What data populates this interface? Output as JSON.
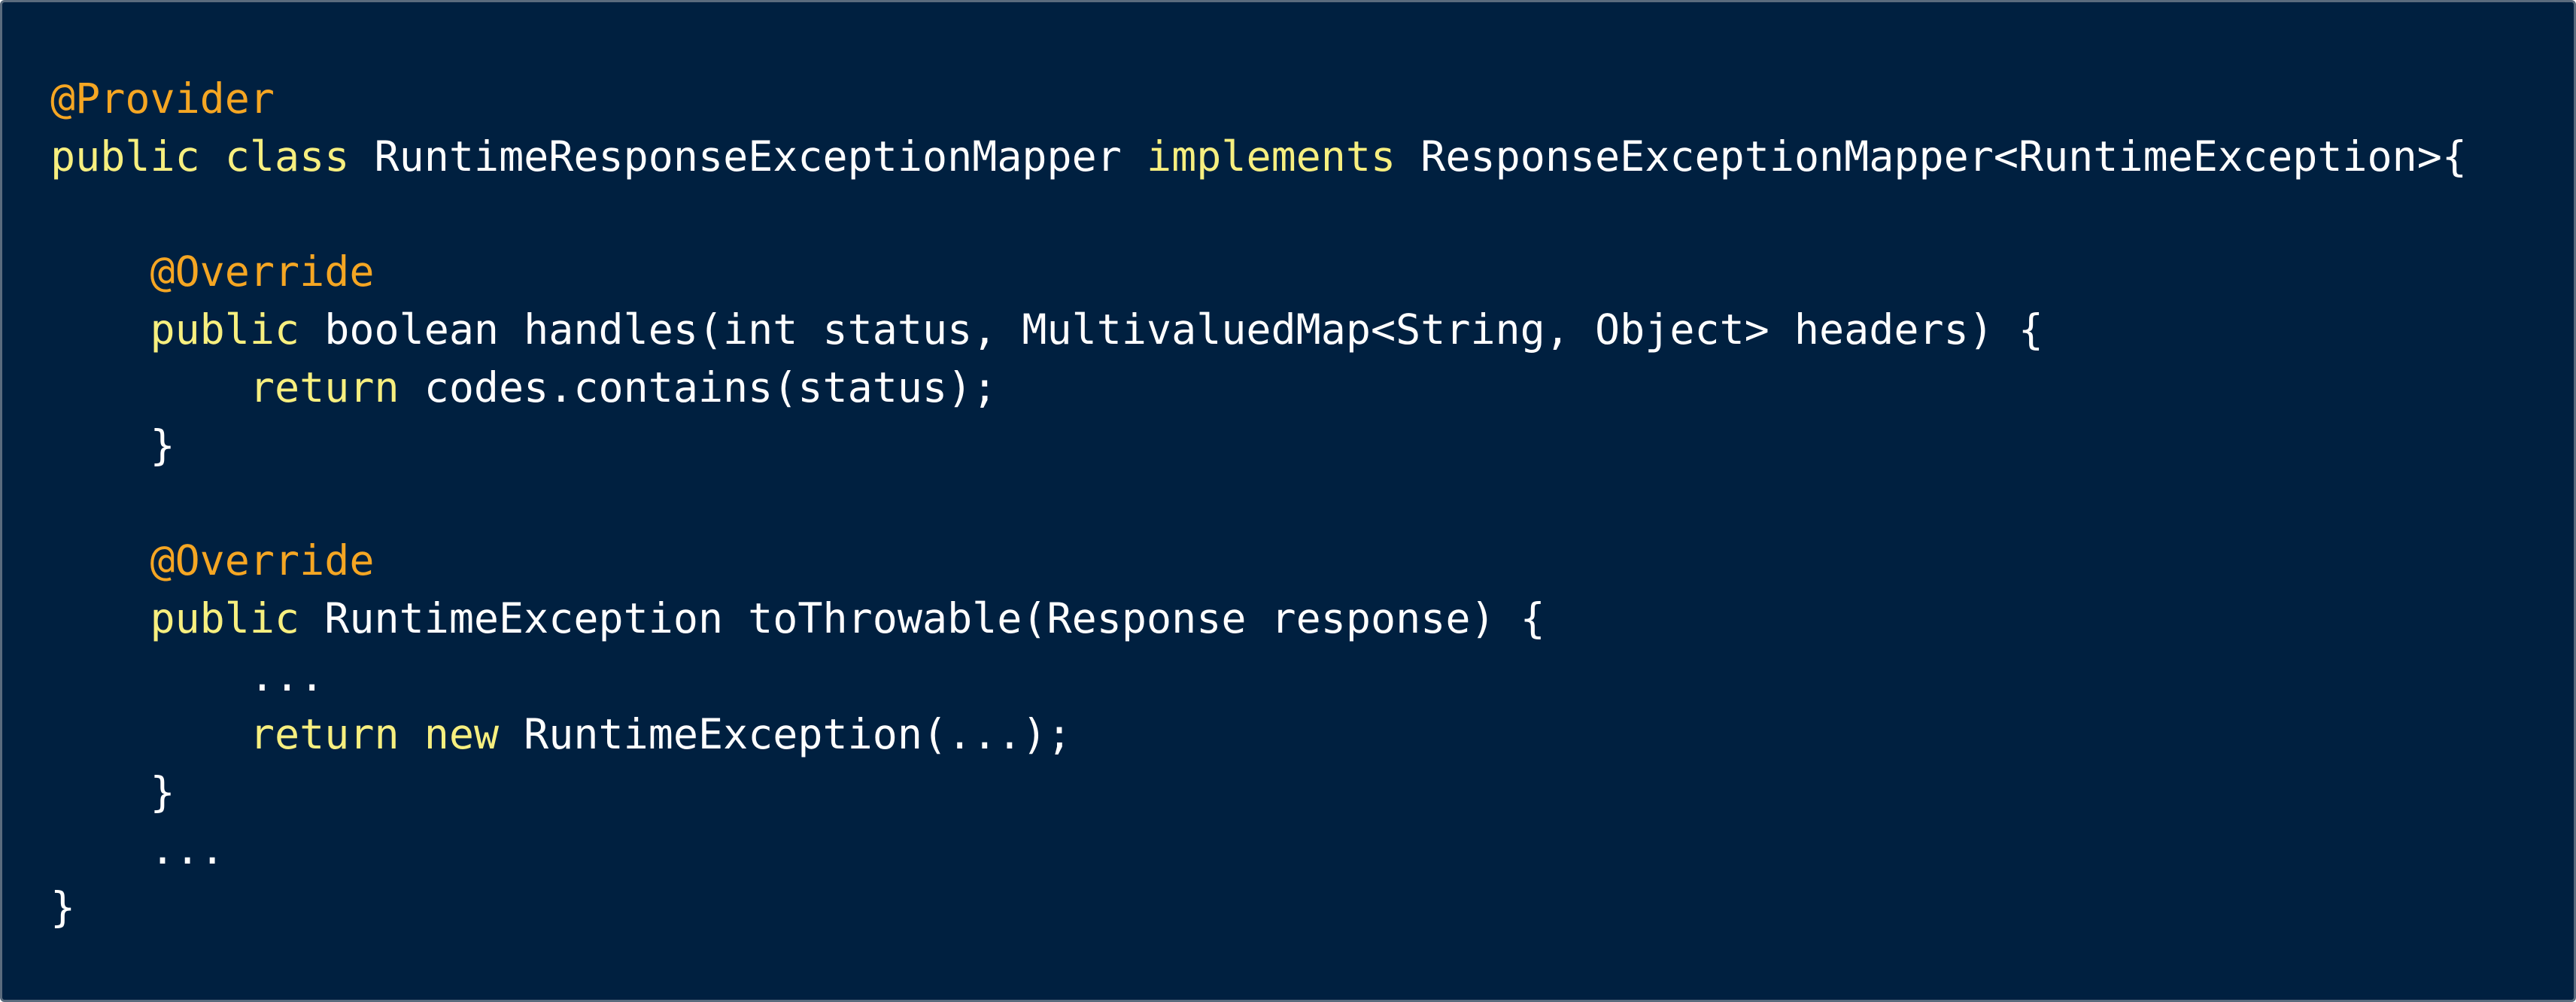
{
  "theme": {
    "background": "#002040",
    "border": "#5a6b7d",
    "annotation_color": "#f5a623",
    "keyword_color": "#f7ef7f",
    "text_color": "#ffffff"
  },
  "code": {
    "lines": [
      [
        {
          "t": "annotation",
          "v": "@Provider"
        }
      ],
      [
        {
          "t": "keyword",
          "v": "public"
        },
        {
          "t": "plain",
          "v": " "
        },
        {
          "t": "keyword",
          "v": "class"
        },
        {
          "t": "plain",
          "v": " RuntimeResponseExceptionMapper "
        },
        {
          "t": "keyword",
          "v": "implements"
        },
        {
          "t": "plain",
          "v": " ResponseExceptionMapper<RuntimeException>{"
        }
      ],
      [],
      [
        {
          "t": "plain",
          "v": "    "
        },
        {
          "t": "annotation",
          "v": "@Override"
        }
      ],
      [
        {
          "t": "plain",
          "v": "    "
        },
        {
          "t": "keyword",
          "v": "public"
        },
        {
          "t": "plain",
          "v": " boolean handles(int status, MultivaluedMap<String, Object> headers) {"
        }
      ],
      [
        {
          "t": "plain",
          "v": "        "
        },
        {
          "t": "keyword",
          "v": "return"
        },
        {
          "t": "plain",
          "v": " codes.contains(status);"
        }
      ],
      [
        {
          "t": "plain",
          "v": "    }"
        }
      ],
      [],
      [
        {
          "t": "plain",
          "v": "    "
        },
        {
          "t": "annotation",
          "v": "@Override"
        }
      ],
      [
        {
          "t": "plain",
          "v": "    "
        },
        {
          "t": "keyword",
          "v": "public"
        },
        {
          "t": "plain",
          "v": " RuntimeException toThrowable(Response response) {"
        }
      ],
      [
        {
          "t": "plain",
          "v": "        ..."
        }
      ],
      [
        {
          "t": "plain",
          "v": "        "
        },
        {
          "t": "keyword",
          "v": "return"
        },
        {
          "t": "plain",
          "v": " "
        },
        {
          "t": "keyword",
          "v": "new"
        },
        {
          "t": "plain",
          "v": " RuntimeException(...);"
        }
      ],
      [
        {
          "t": "plain",
          "v": "    }"
        }
      ],
      [
        {
          "t": "plain",
          "v": "    ..."
        }
      ],
      [
        {
          "t": "plain",
          "v": "}"
        }
      ]
    ]
  }
}
